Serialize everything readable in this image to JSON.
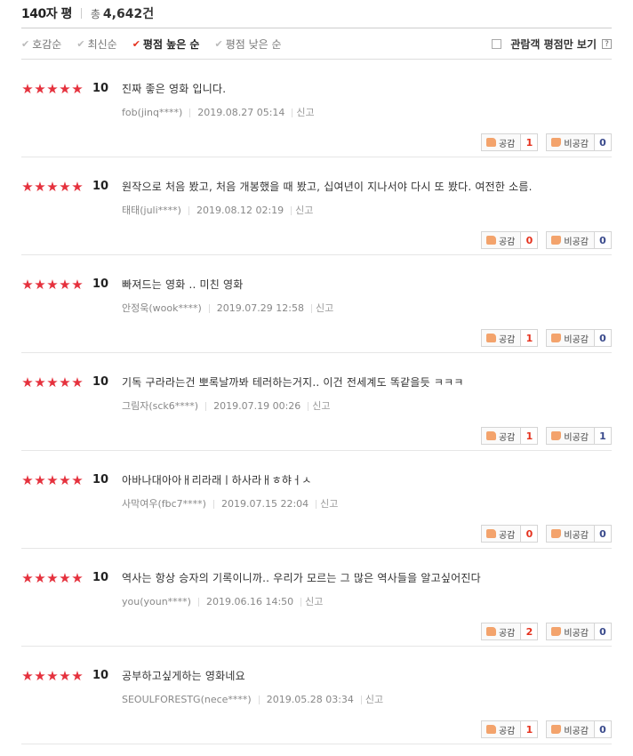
{
  "header": {
    "title": "140자 평",
    "total_label": "총",
    "total_count": "4,642건"
  },
  "sort": [
    {
      "label": "호감순",
      "active": false
    },
    {
      "label": "최신순",
      "active": false
    },
    {
      "label": "평점 높은 순",
      "active": true
    },
    {
      "label": "평점 낮은 순",
      "active": false
    }
  ],
  "audience_filter": {
    "label": "관람객 평점만 보기",
    "help": "?"
  },
  "vote_labels": {
    "up": "공감",
    "down": "비공감"
  },
  "colors": {
    "star": "#e5313d",
    "accent": "#e5321e",
    "down_count": "#3a4a8c"
  },
  "reviews": [
    {
      "stars": 5,
      "score": "10",
      "text": "진짜 좋은 영화 입니다.",
      "author": "fob(jinq****)",
      "date": "2019.08.27 05:14",
      "report": "신고",
      "up": "1",
      "down": "0"
    },
    {
      "stars": 5,
      "score": "10",
      "text": "원작으로 처음 봤고, 처음 개봉했을 때 봤고, 십여년이 지나서야 다시 또 봤다. 여전한 소름.",
      "author": "태태(juli****)",
      "date": "2019.08.12 02:19",
      "report": "신고",
      "up": "0",
      "down": "0"
    },
    {
      "stars": 5,
      "score": "10",
      "text": "빠져드는 영화 .. 미친 영화",
      "author": "안정욱(wook****)",
      "date": "2019.07.29 12:58",
      "report": "신고",
      "up": "1",
      "down": "0"
    },
    {
      "stars": 5,
      "score": "10",
      "text": "기독 구라라는건 뽀록날까봐 테러하는거지.. 이건 전세계도 똑같을듯 ㅋㅋㅋ",
      "author": "그림자(sck6****)",
      "date": "2019.07.19 00:26",
      "report": "신고",
      "up": "1",
      "down": "1"
    },
    {
      "stars": 5,
      "score": "10",
      "text": "아바나대아아ㅐ리라래ㅣ하사라ㅐㅎ햐ㅓㅅ",
      "author": "사막여우(fbc7****)",
      "date": "2019.07.15 22:04",
      "report": "신고",
      "up": "0",
      "down": "0"
    },
    {
      "stars": 5,
      "score": "10",
      "text": "역사는 항상 승자의 기록이니까.. 우리가 모르는 그 많은 역사들을 알고싶어진다",
      "author": "you(youn****)",
      "date": "2019.06.16 14:50",
      "report": "신고",
      "up": "2",
      "down": "0"
    },
    {
      "stars": 5,
      "score": "10",
      "text": "공부하고싶게하는 영화네요",
      "author": "SEOULFORESTG(nece****)",
      "date": "2019.05.28 03:34",
      "report": "신고",
      "up": "1",
      "down": "0"
    }
  ]
}
